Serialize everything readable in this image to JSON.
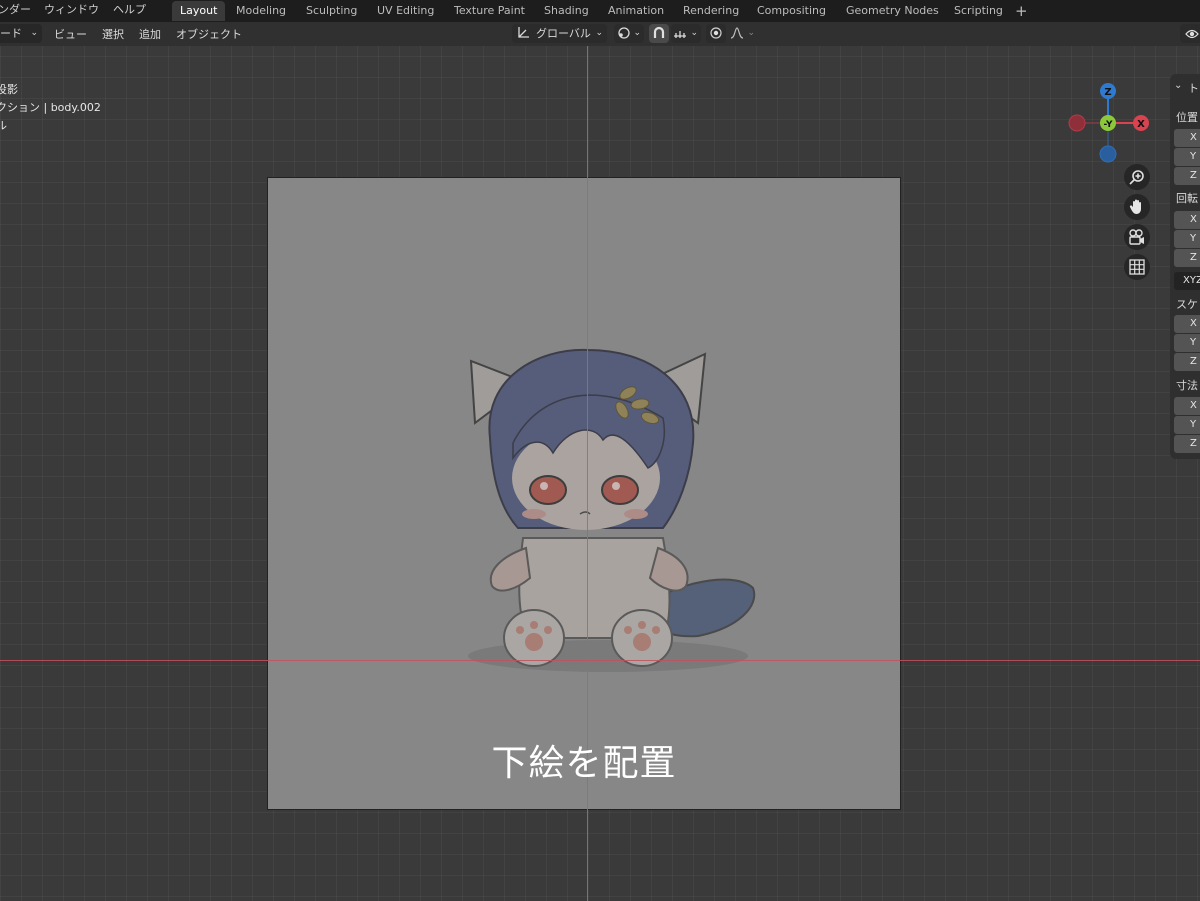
{
  "top_menu": {
    "items": [
      "ンダー",
      "ウィンドウ",
      "ヘルプ"
    ]
  },
  "workspaces": {
    "tabs": [
      "Layout",
      "Modeling",
      "Sculpting",
      "UV Editing",
      "Texture Paint",
      "Shading",
      "Animation",
      "Rendering",
      "Compositing",
      "Geometry Nodes",
      "Scripting"
    ],
    "active": "Layout",
    "add": "+"
  },
  "header": {
    "mode": "ード",
    "menus": [
      "ビュー",
      "選択",
      "追加",
      "オブジェクト"
    ],
    "orientation": "グローバル"
  },
  "viewport": {
    "overlay_lines": [
      "投影",
      "クション | body.002",
      "ル"
    ],
    "caption": "下絵を配置",
    "gizmo": {
      "z": "Z",
      "y": "-Y",
      "x": "X"
    }
  },
  "n_panel": {
    "title": "ト",
    "location_label": "位置",
    "rotation_label": "回転",
    "scale_label": "スケ",
    "dimensions_label": "寸法",
    "rotation_mode": "XYZ",
    "axes": [
      "X",
      "Y",
      "Z"
    ]
  },
  "colors": {
    "x_axis": "#c3505e",
    "y_axis": "#4f83cc",
    "gizmo_z": "#2f7ad1",
    "gizmo_x": "#d9424f",
    "gizmo_y": "#8bc93a"
  }
}
